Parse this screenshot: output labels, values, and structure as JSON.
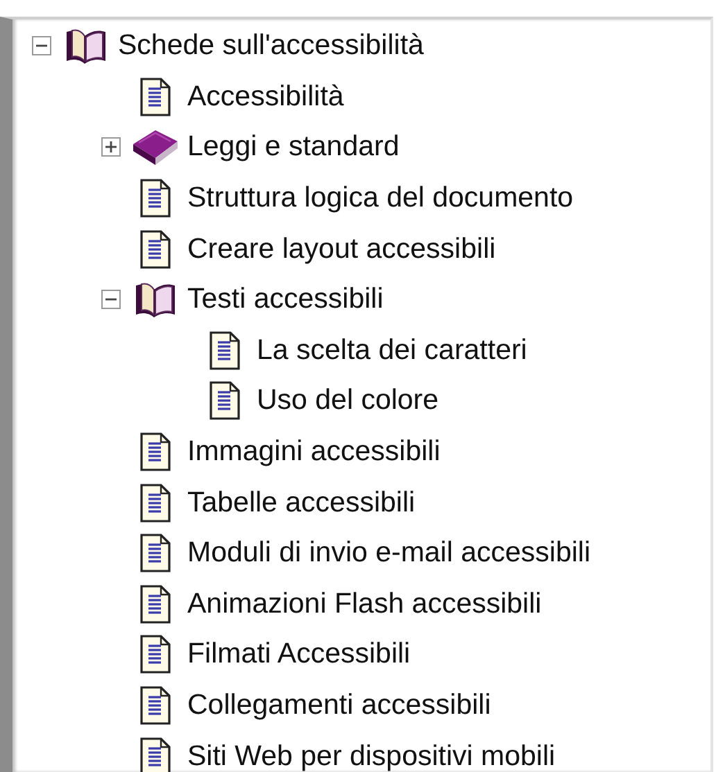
{
  "tree": {
    "nodes": [
      {
        "label": "Schede sull'accessibilità",
        "kind": "book",
        "expanded": true,
        "children": [
          {
            "label": "Accessibilità",
            "kind": "page"
          },
          {
            "label": "Leggi e standard",
            "kind": "book",
            "expanded": false
          },
          {
            "label": "Struttura logica del documento",
            "kind": "page"
          },
          {
            "label": "Creare layout accessibili",
            "kind": "page"
          },
          {
            "label": "Testi accessibili",
            "kind": "book",
            "expanded": true,
            "children": [
              {
                "label": "La scelta dei caratteri",
                "kind": "page"
              },
              {
                "label": "Uso del colore",
                "kind": "page"
              }
            ]
          },
          {
            "label": "Immagini accessibili",
            "kind": "page"
          },
          {
            "label": "Tabelle accessibili",
            "kind": "page"
          },
          {
            "label": "Moduli di invio e-mail accessibili",
            "kind": "page"
          },
          {
            "label": "Animazioni Flash accessibili",
            "kind": "page"
          },
          {
            "label": "Filmati Accessibili",
            "kind": "page"
          },
          {
            "label": "Collegamenti accessibili",
            "kind": "page"
          },
          {
            "label": "Siti Web per dispositivi mobili",
            "kind": "page"
          }
        ]
      }
    ]
  }
}
